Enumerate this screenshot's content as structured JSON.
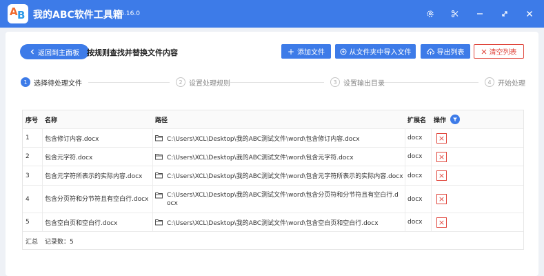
{
  "app": {
    "title": "我的ABC软件工具箱",
    "version": "v6.16.0",
    "logo_letters": [
      "A",
      "B"
    ]
  },
  "colors": {
    "brand": "#3d7be8",
    "danger": "#e0463c",
    "logo_a": "#f06a2d",
    "logo_b": "#2f9be8"
  },
  "titlebar_icons": [
    "settings-icon",
    "scissors-icon",
    "minimize-icon",
    "expand-icon",
    "close-icon"
  ],
  "toolbar": {
    "back_label": "返回到主面板",
    "page_title": "按规则查找并替换文件内容",
    "add_file": "添加文件",
    "import_folder": "从文件夹中导入文件",
    "export_list": "导出列表",
    "clear_list": "清空列表"
  },
  "steps": [
    {
      "num": "1",
      "label": "选择待处理文件"
    },
    {
      "num": "2",
      "label": "设置处理规则"
    },
    {
      "num": "3",
      "label": "设置输出目录"
    },
    {
      "num": "4",
      "label": "开始处理"
    }
  ],
  "table": {
    "headers": {
      "idx": "序号",
      "name": "名称",
      "path": "路径",
      "ext": "扩展名",
      "op": "操作"
    },
    "rows": [
      {
        "idx": "1",
        "name": "包含修订内容.docx",
        "path": "C:\\Users\\XCL\\Desktop\\我的ABC测试文件\\word\\包含修订内容.docx",
        "ext": "docx"
      },
      {
        "idx": "2",
        "name": "包含元字符.docx",
        "path": "C:\\Users\\XCL\\Desktop\\我的ABC测试文件\\word\\包含元字符.docx",
        "ext": "docx"
      },
      {
        "idx": "3",
        "name": "包含元字符所表示的实际内容.docx",
        "path": "C:\\Users\\XCL\\Desktop\\我的ABC测试文件\\word\\包含元字符所表示的实际内容.docx",
        "ext": "docx"
      },
      {
        "idx": "4",
        "name": "包含分页符和分节符且有空白行.docx",
        "path": "C:\\Users\\XCL\\Desktop\\我的ABC测试文件\\word\\包含分页符和分节符且有空白行.docx",
        "ext": "docx"
      },
      {
        "idx": "5",
        "name": "包含空白页和空白行.docx",
        "path": "C:\\Users\\XCL\\Desktop\\我的ABC测试文件\\word\\包含空白页和空白行.docx",
        "ext": "docx"
      }
    ],
    "summary_label": "汇总",
    "summary_count": "记录数：5"
  }
}
